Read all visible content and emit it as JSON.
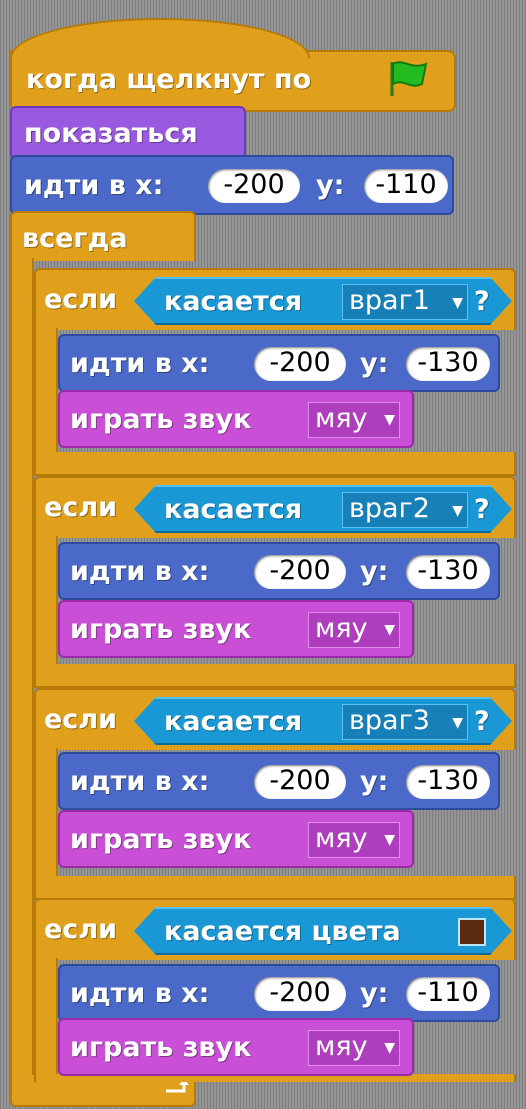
{
  "colors": {
    "control": "#e0a01b",
    "looks": "#9a5ae0",
    "motion": "#4a69c8",
    "sound": "#c94fd6",
    "sensing": "#1a98d6",
    "flag": "#22bb22",
    "touch_color_swatch": "#5a2a0e"
  },
  "hat": {
    "label": "когда щелкнут по",
    "icon": "green-flag-icon"
  },
  "show": {
    "label": "показаться"
  },
  "goto1": {
    "label": "идти в x:",
    "x": "-200",
    "ylabel": "y:",
    "y": "-110"
  },
  "forever": {
    "label": "всегда",
    "loop_icon": "loop-arrow-icon"
  },
  "if_blocks": [
    {
      "if_label": "если",
      "sense_label": "касается",
      "target": "враг1",
      "q": "?",
      "goto_label": "идти в x:",
      "x": "-200",
      "ylabel": "y:",
      "y": "-130",
      "sound_label": "играть звук",
      "sound": "мяу"
    },
    {
      "if_label": "если",
      "sense_label": "касается",
      "target": "враг2",
      "q": "?",
      "goto_label": "идти в x:",
      "x": "-200",
      "ylabel": "y:",
      "y": "-130",
      "sound_label": "играть звук",
      "sound": "мяу"
    },
    {
      "if_label": "если",
      "sense_label": "касается",
      "target": "враг3",
      "q": "?",
      "goto_label": "идти в x:",
      "x": "-200",
      "ylabel": "y:",
      "y": "-130",
      "sound_label": "играть звук",
      "sound": "мяу"
    },
    {
      "if_label": "если",
      "sense_label": "касается цвета",
      "goto_label": "идти в x:",
      "x": "-200",
      "ylabel": "y:",
      "y": "-110",
      "sound_label": "играть звук",
      "sound": "мяу"
    }
  ]
}
